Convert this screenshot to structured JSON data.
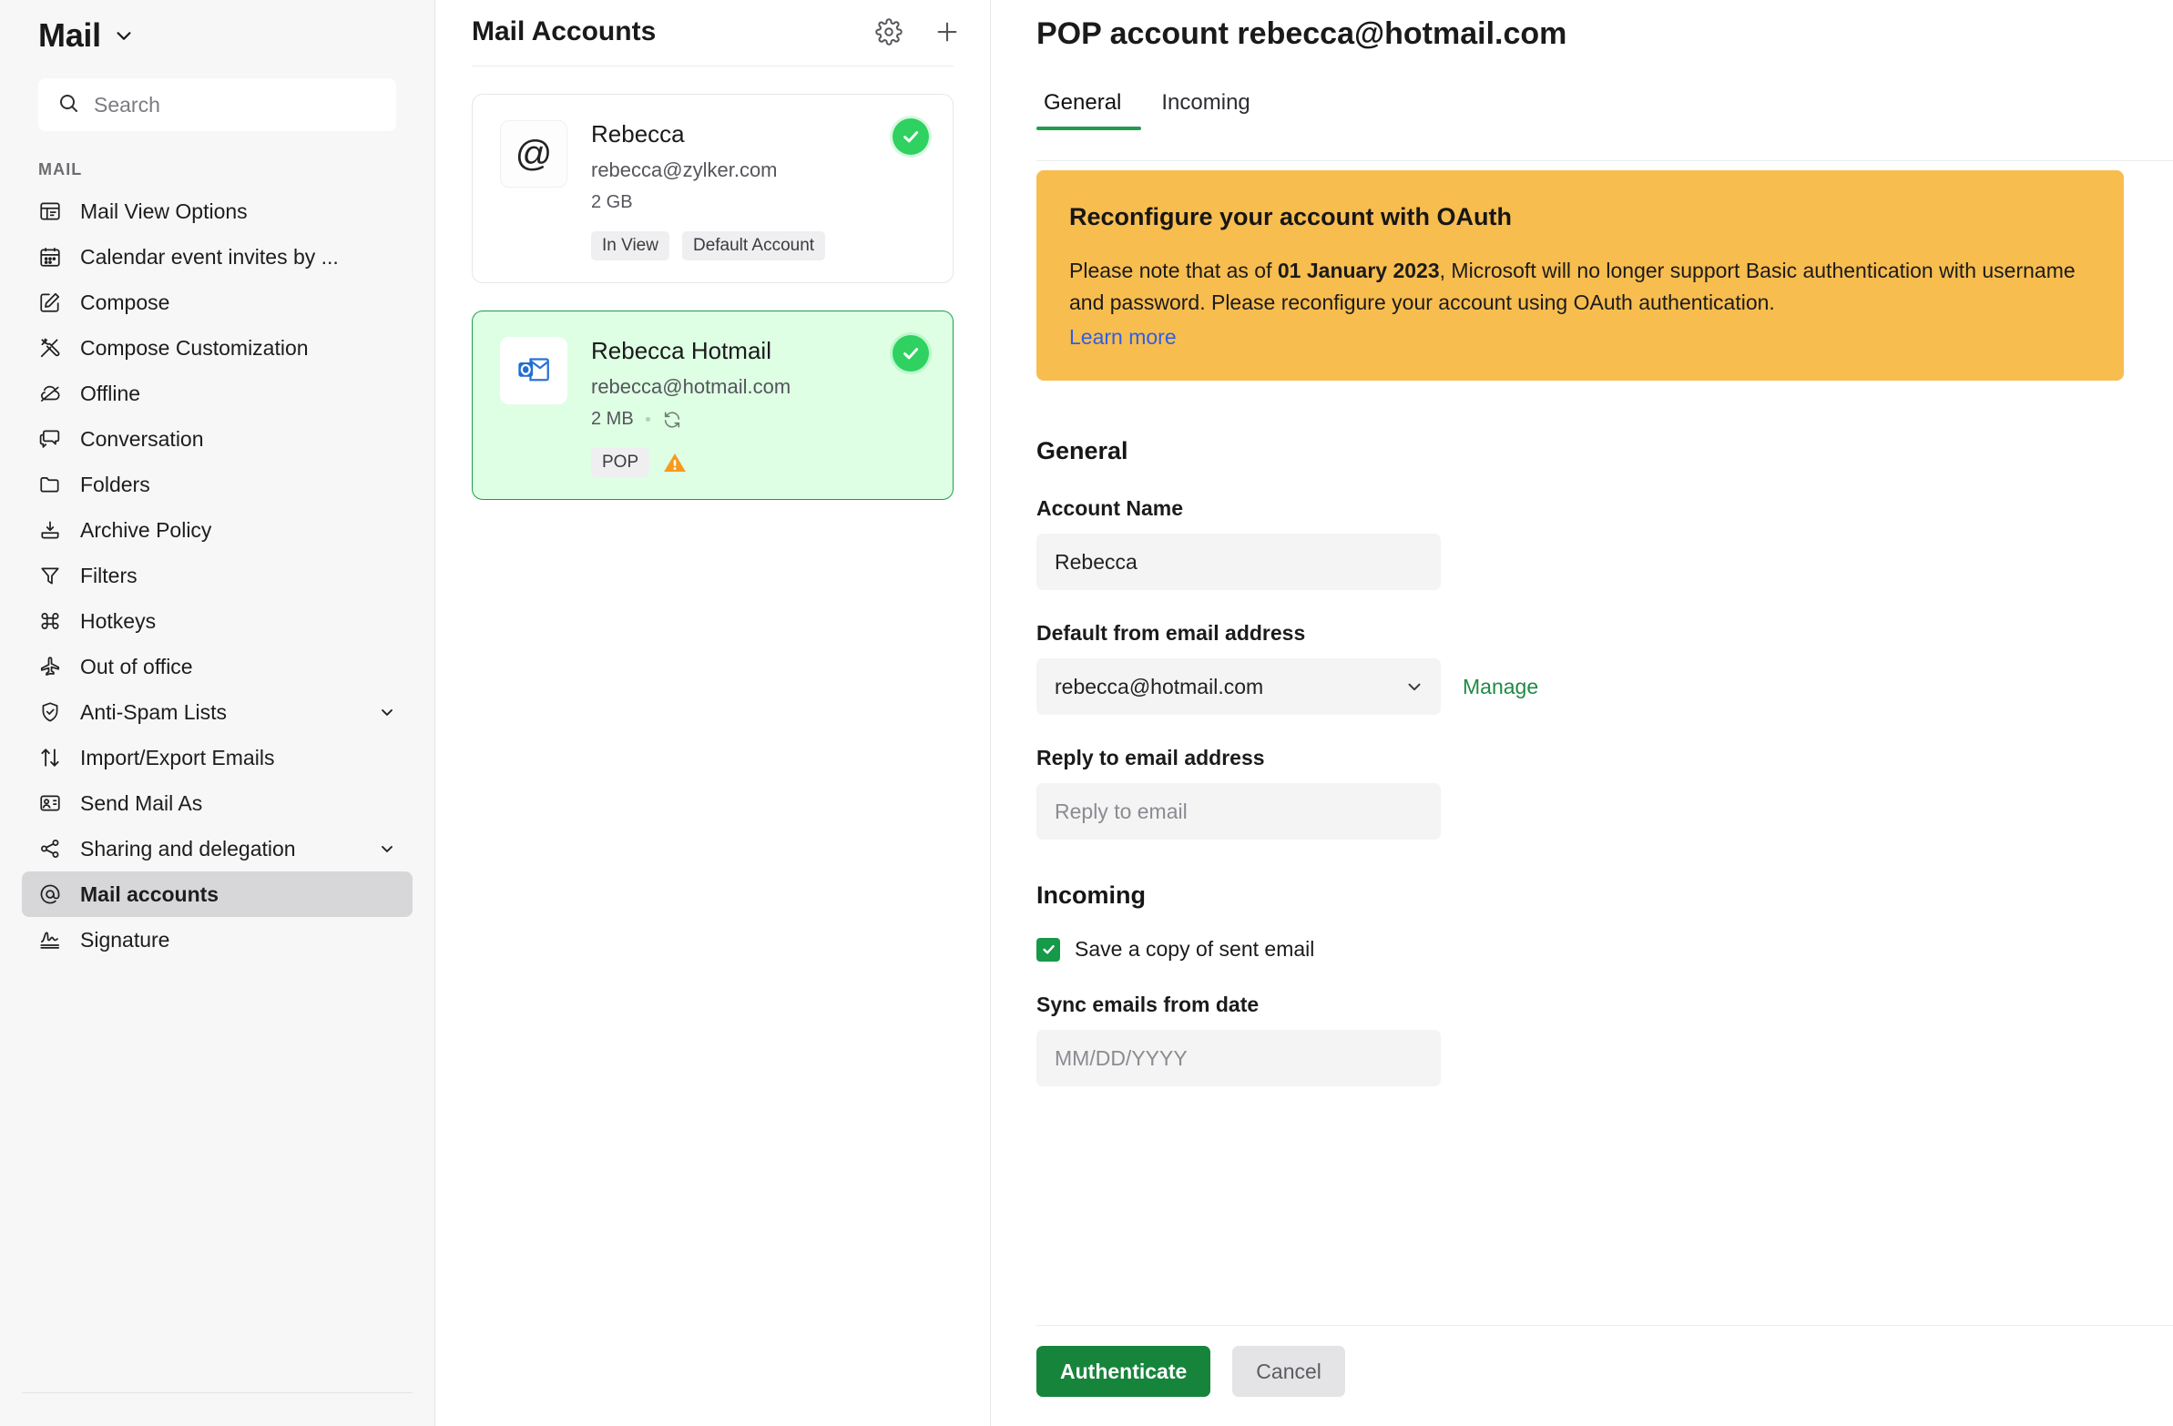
{
  "sidebar": {
    "title": "Mail",
    "search": {
      "placeholder": "Search",
      "value": ""
    },
    "section_label": "MAIL",
    "items": [
      {
        "label": "Mail View Options",
        "icon": "mail-view-options-icon"
      },
      {
        "label": "Calendar event invites by ...",
        "icon": "calendar-icon"
      },
      {
        "label": "Compose",
        "icon": "compose-icon"
      },
      {
        "label": "Compose Customization",
        "icon": "compose-customization-icon"
      },
      {
        "label": "Offline",
        "icon": "offline-cloud-icon"
      },
      {
        "label": "Conversation",
        "icon": "conversation-icon"
      },
      {
        "label": "Folders",
        "icon": "folder-icon"
      },
      {
        "label": "Archive Policy",
        "icon": "archive-icon"
      },
      {
        "label": "Filters",
        "icon": "filter-icon"
      },
      {
        "label": "Hotkeys",
        "icon": "hotkeys-icon"
      },
      {
        "label": "Out of office",
        "icon": "airplane-icon"
      },
      {
        "label": "Anti-Spam Lists",
        "icon": "shield-check-icon"
      },
      {
        "label": "Import/Export Emails",
        "icon": "import-export-icon"
      },
      {
        "label": "Send Mail As",
        "icon": "send-mail-as-icon"
      },
      {
        "label": "Sharing and delegation",
        "icon": "share-icon"
      },
      {
        "label": "Mail accounts",
        "icon": "at-icon"
      },
      {
        "label": "Signature",
        "icon": "signature-icon"
      }
    ]
  },
  "accounts_panel": {
    "title": "Mail Accounts",
    "settings_icon": "gear-icon",
    "add_icon": "plus-icon",
    "cards": [
      {
        "name": "Rebecca",
        "email": "rebecca@zylker.com",
        "size": "2 GB",
        "avatar_icon": "at-icon",
        "status_icon": "check-circle-icon",
        "tags": [
          "In View",
          "Default Account"
        ]
      },
      {
        "name": "Rebecca Hotmail",
        "email": "rebecca@hotmail.com",
        "size": "2 MB",
        "avatar_icon": "outlook-icon",
        "sync_icon": "sync-icon",
        "status_icon": "check-circle-icon",
        "tags": [
          "POP"
        ],
        "warning_icon": "warning-triangle-icon"
      }
    ]
  },
  "main": {
    "title": "POP account rebecca@hotmail.com",
    "tabs": [
      {
        "label": "General"
      },
      {
        "label": "Incoming"
      }
    ],
    "banner": {
      "title": "Reconfigure your account with OAuth",
      "text_before": "Please note that as of ",
      "text_bold": "01 January 2023",
      "text_after": ", Microsoft will no longer support Basic authentication with username and password. Please reconfigure your account using OAuth authentication.",
      "link": "Learn more"
    },
    "general": {
      "heading": "General",
      "account_name_label": "Account Name",
      "account_name_value": "Rebecca",
      "default_from_label": "Default from email address",
      "default_from_value": "rebecca@hotmail.com",
      "manage_link": "Manage",
      "reply_to_label": "Reply to email address",
      "reply_to_placeholder": "Reply to email",
      "reply_to_value": ""
    },
    "incoming": {
      "heading": "Incoming",
      "save_copy_label": "Save a copy of sent email",
      "save_copy_checked": true,
      "sync_date_label": "Sync emails from date",
      "sync_date_placeholder": "MM/DD/YYYY",
      "sync_date_value": ""
    },
    "footer": {
      "primary_button": "Authenticate",
      "secondary_button": "Cancel"
    }
  },
  "colors": {
    "accent_green": "#17843c",
    "link_green": "#1f8a46",
    "banner_orange": "#f8bd4f",
    "status_green": "#2fd160",
    "link_blue": "#2f5fe0",
    "selected_card_bg": "#deffe4",
    "warning_orange": "#f99a1c"
  }
}
